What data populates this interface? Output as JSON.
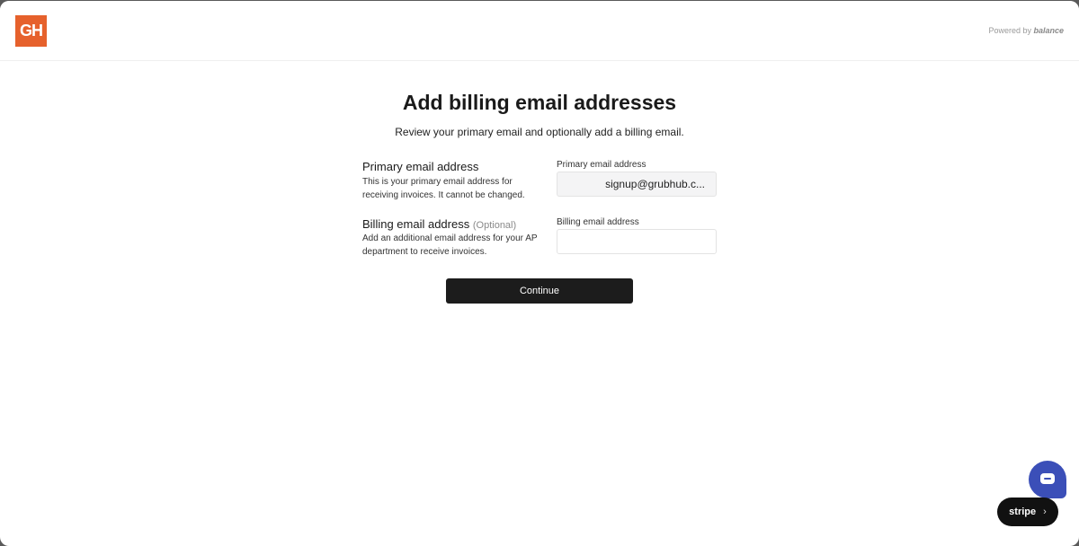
{
  "header": {
    "logo_text": "GH",
    "powered_prefix": "Powered by ",
    "powered_brand": "balance"
  },
  "main": {
    "title": "Add billing email addresses",
    "subtitle": "Review your primary email and optionally add a billing email.",
    "primary": {
      "title": "Primary email address",
      "description": "This is your primary email address for receiving invoices. It cannot be changed.",
      "field_label": "Primary email address",
      "value": "signup@grubhub.c..."
    },
    "billing": {
      "title": "Billing email address",
      "optional": "(Optional)",
      "description": "Add an additional email address for your AP department to receive invoices.",
      "field_label": "Billing email address",
      "value": "",
      "placeholder": ""
    },
    "continue_label": "Continue"
  },
  "widgets": {
    "stripe_label": "stripe",
    "stripe_chevron": "›"
  },
  "colors": {
    "brand": "#e6612c",
    "button": "#1c1c1c",
    "chat": "#3b4fb8"
  }
}
